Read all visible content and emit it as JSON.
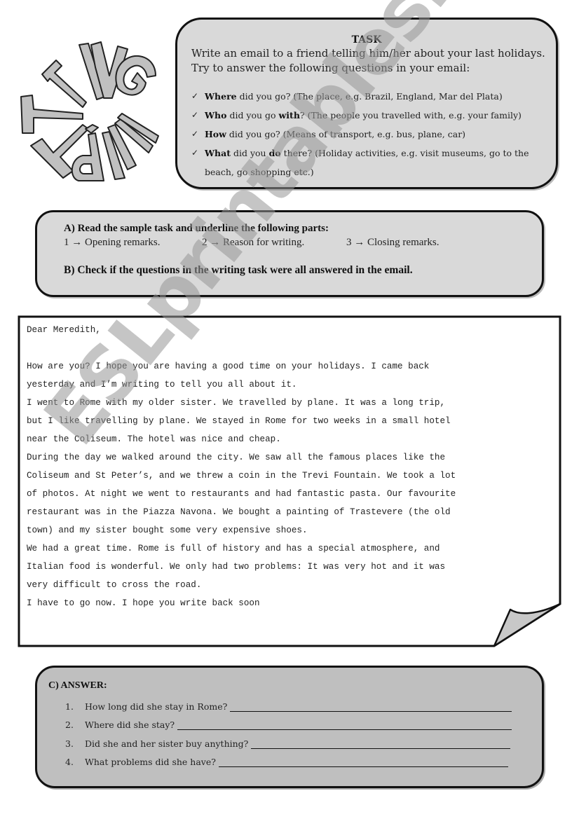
{
  "logo": {
    "word": "WRITING",
    "description": "Circular arranged letters spelling WRITING"
  },
  "task": {
    "title": "TASK",
    "description": "Write an email to a friend telling him/her about your last holidays. Try to answer the following questions in your email:",
    "check_icon": "check-mark-icon",
    "questions": [
      {
        "bold1": "Where",
        "mid": " did you go? (The place, e.g. Brazil, England, Mar del Plata)",
        "bold2": "",
        "rest": ""
      },
      {
        "bold1": "Who",
        "mid": " did you go ",
        "bold2": "with",
        "rest": "? (The people you travelled with, e.g. your family)"
      },
      {
        "bold1": "How",
        "mid": " did you go? (Means of transport, e.g. bus, plane, car)",
        "bold2": "",
        "rest": ""
      },
      {
        "bold1": "What",
        "mid": " did you ",
        "bold2": "do",
        "rest": " there? (Holiday activities, e.g. visit museums, go to the beach, go shopping etc.)"
      }
    ]
  },
  "instructions": {
    "a_label": "A)  Read the sample task and underline the following parts:",
    "parts": [
      "1 → Opening remarks.",
      "2 → Reason for writing.",
      "3 → Closing remarks."
    ],
    "b_label": "B) Check if the questions in the writing task were all answered in the email."
  },
  "email": {
    "lines": [
      "Dear Meredith,",
      "",
      "How are you? I hope you are having a good time on your holidays. I came back",
      "yesterday and I’m writing to tell you all about it.",
      "I went to Rome with my older sister. We travelled by plane. It was a long trip,",
      "but I like travelling by plane. We stayed in Rome for two weeks in a small hotel",
      "near the Coliseum. The hotel was nice and cheap.",
      "During the day we walked around the city. We saw all the famous places like the",
      "Coliseum and St Peter’s, and we threw a coin in the Trevi Fountain. We took a lot",
      "of photos. At night we went to restaurants and had fantastic pasta. Our favourite",
      "restaurant was in the Piazza Navona. We bought a painting of Trastevere (the old",
      "town) and my sister bought some very expensive shoes.",
      "We had a great time. Rome is full of history and has a special atmosphere, and",
      "Italian food is wonderful. We only had two problems: It was very hot and it was",
      "very difficult to cross the road.",
      "I have to go now. I hope you write back soon"
    ]
  },
  "answer": {
    "title": "C) ANSWER:",
    "questions": [
      {
        "num": "1.",
        "text": "How long did she stay in Rome?"
      },
      {
        "num": "2.",
        "text": "Where did she stay?"
      },
      {
        "num": "3.",
        "text": "Did she and her sister buy anything?"
      },
      {
        "num": "4.",
        "text": "What problems did she have?"
      }
    ]
  },
  "watermark": "ESLprintables.com",
  "colors": {
    "box_fill_light": "#d9d9d9",
    "box_fill_dark": "#bfbfbf",
    "border": "#111111",
    "logo_letter_fill": "#c0c0c0",
    "page_curl_fill": "#c8c8c8"
  }
}
